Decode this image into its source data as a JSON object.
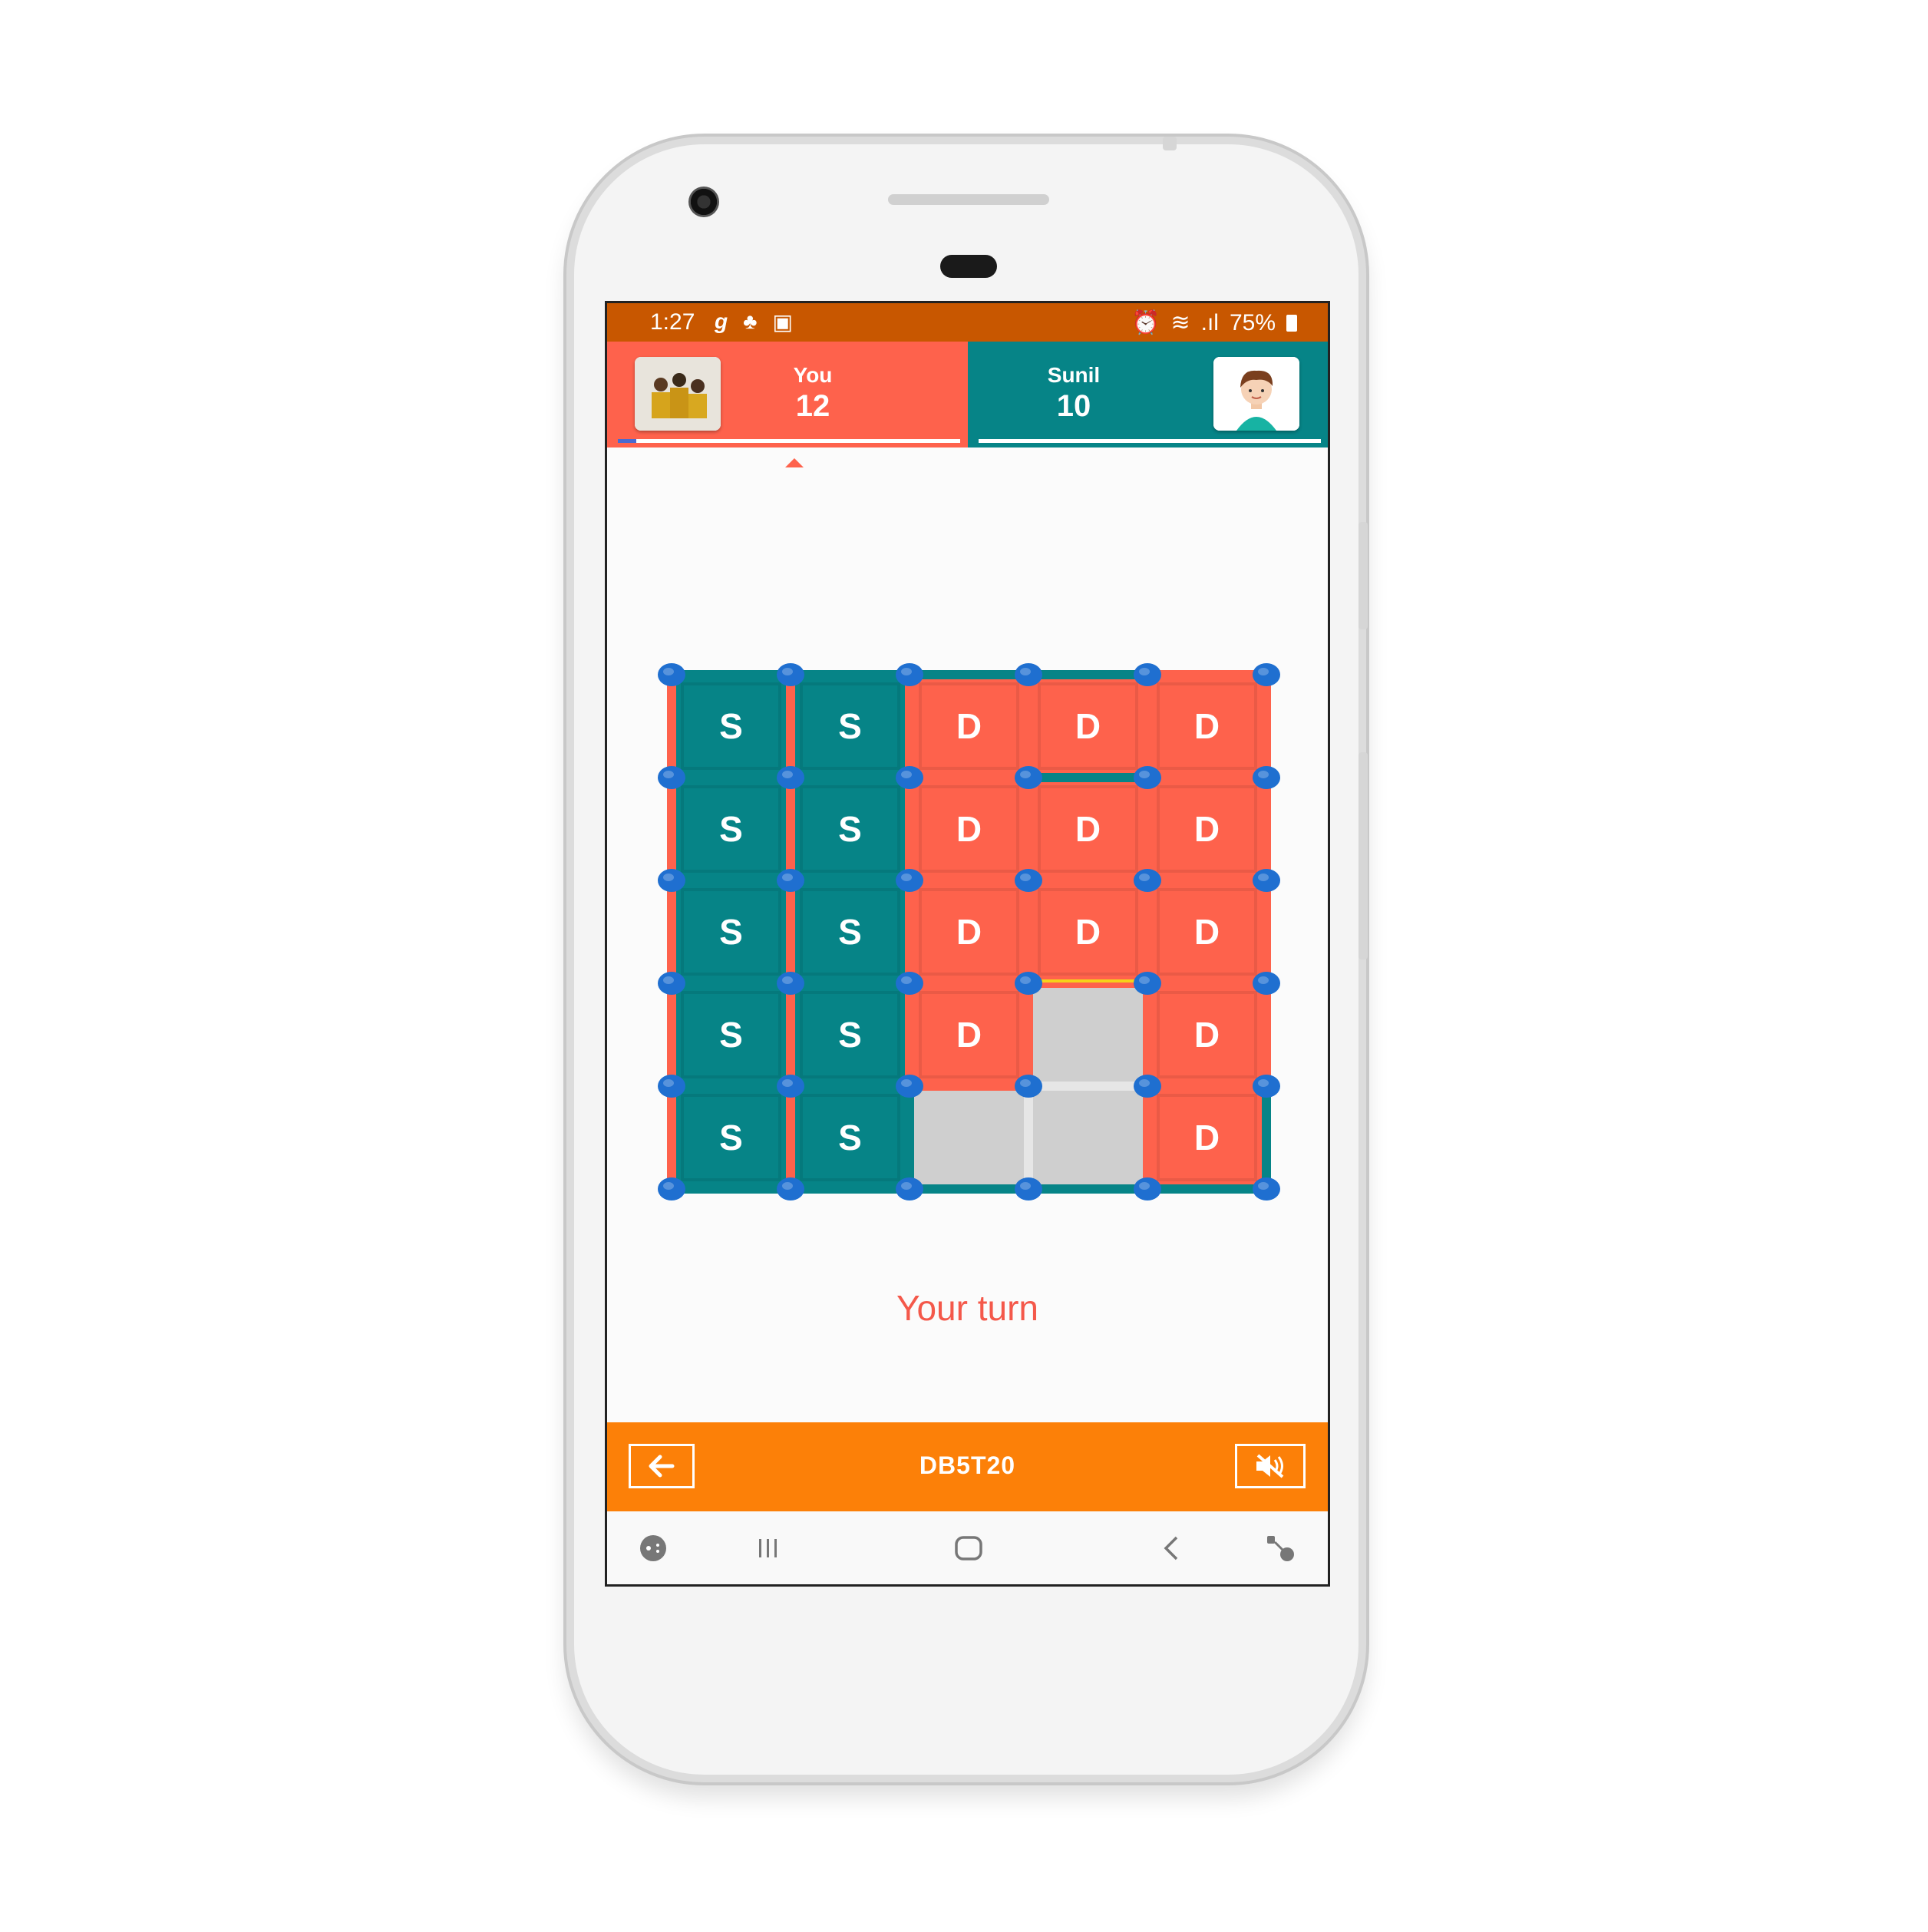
{
  "status_bar": {
    "time": "1:27",
    "battery": "75%",
    "left_icons": [
      "g-icon",
      "notification-icon",
      "image-icon"
    ],
    "right_icons": [
      "alarm-icon",
      "wifi-icon",
      "signal-icon",
      "battery-icon"
    ]
  },
  "players": {
    "you": {
      "name": "You",
      "score": "12",
      "color": "#fe624c",
      "letter": "D"
    },
    "opponent": {
      "name": "Sunil",
      "score": "10",
      "color": "#068487",
      "letter": "S"
    }
  },
  "board": {
    "rows": 5,
    "cols": 5,
    "dot_color": "#1f6fd0",
    "line_you_color": "#fe624c",
    "line_opponent_color": "#068487",
    "empty_cell_color": "#cfcfcf",
    "last_move_color": "#f5d21a",
    "cells": [
      [
        "S",
        "S",
        "D",
        "D",
        "D"
      ],
      [
        "S",
        "S",
        "D",
        "D",
        "D"
      ],
      [
        "S",
        "S",
        "D",
        "D",
        "D"
      ],
      [
        "S",
        "S",
        "D",
        "",
        "D"
      ],
      [
        "S",
        "S",
        "",
        "",
        "D"
      ]
    ]
  },
  "turn_text": "Your turn",
  "bottom_bar": {
    "room_code": "DB5T20",
    "back_icon": "arrow-left-icon",
    "sound_icon": "mute-icon"
  },
  "nav_bar": [
    "game-icon",
    "recents-icon",
    "home-icon",
    "back-chevron-icon",
    "assist-icon"
  ]
}
